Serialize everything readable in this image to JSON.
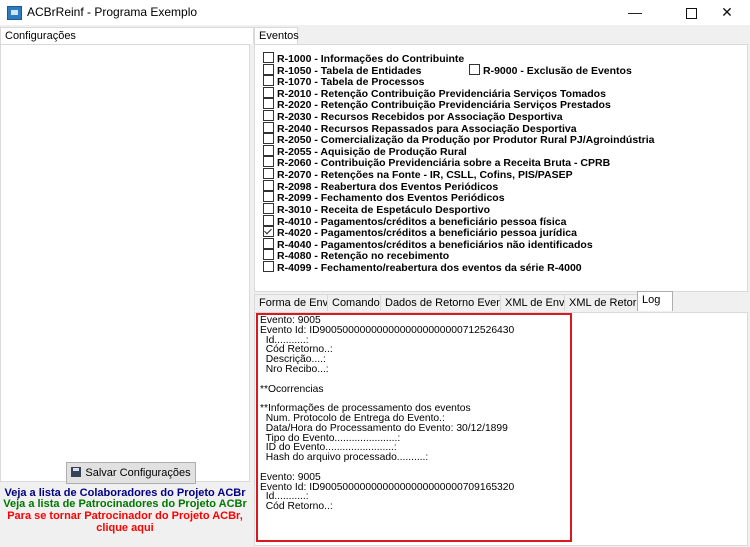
{
  "window": {
    "title": "ACBrReinf - Programa Exemplo"
  },
  "left_panel": {
    "tab_label": "Configurações",
    "save_button": "Salvar Configurações",
    "link_colaboradores": "Veja a lista de Colaboradores do Projeto ACBr",
    "link_patrocinadores": "Veja a lista de Patrocinadores do Projeto ACBr",
    "link_patrocinar_line1": "Para se tornar Patrocinador do Projeto ACBr,",
    "link_patrocinar_line2": "clique aqui",
    "colors": {
      "colaboradores": "#000080",
      "patrocinadores": "#007700",
      "patrocinar": "#ff0000"
    }
  },
  "eventos": {
    "tab_label": "Eventos",
    "items": [
      {
        "label": "R-1000 - Informações do Contribuinte",
        "checked": false
      },
      {
        "label": "R-1050 - Tabela de Entidades",
        "checked": false
      },
      {
        "label": "R-1070 - Tabela de Processos",
        "checked": false
      },
      {
        "label": "R-2010 - Retenção Contribuição Previdenciária  Serviços Tomados",
        "checked": false
      },
      {
        "label": "R-2020 - Retenção Contribuição Previdenciária  Serviços Prestados",
        "checked": false
      },
      {
        "label": "R-2030 - Recursos Recebidos por Associação Desportiva",
        "checked": false
      },
      {
        "label": "R-2040 - Recursos Repassados para Associação Desportiva",
        "checked": false
      },
      {
        "label": "R-2050 - Comercialização da Produção por Produtor Rural PJ/Agroindústria",
        "checked": false
      },
      {
        "label": "R-2055 - Aquisição de Produção Rural",
        "checked": false
      },
      {
        "label": "R-2060 - Contribuição Previdenciária sobre a Receita Bruta - CPRB",
        "checked": false
      },
      {
        "label": "R-2070 - Retenções na Fonte - IR, CSLL, Cofins, PIS/PASEP",
        "checked": false
      },
      {
        "label": "R-2098 - Reabertura dos Eventos Periódicos",
        "checked": false
      },
      {
        "label": "R-2099 - Fechamento dos Eventos Periódicos",
        "checked": false
      },
      {
        "label": "R-3010 - Receita de Espetáculo Desportivo",
        "checked": false
      },
      {
        "label": "R-4010 - Pagamentos/créditos a beneficiário pessoa física",
        "checked": false
      },
      {
        "label": "R-4020 - Pagamentos/créditos a beneficiário pessoa jurídica",
        "checked": true
      },
      {
        "label": "R-4040 - Pagamentos/créditos a beneficiários não identificados",
        "checked": false
      },
      {
        "label": "R-4080 - Retenção no recebimento",
        "checked": false
      },
      {
        "label": "R-4099 - Fechamento/reabertura dos eventos da série R-4000",
        "checked": false
      }
    ],
    "extra_item": {
      "label": "R-9000 - Exclusão de Eventos",
      "checked": false
    }
  },
  "bottom_tabs": [
    {
      "label": "Forma de Envio",
      "active": false
    },
    {
      "label": "Comandos",
      "active": false
    },
    {
      "label": "Dados de Retorno Eventos",
      "active": false
    },
    {
      "label": "XML de Envio",
      "active": false
    },
    {
      "label": "XML de Retorno",
      "active": false
    },
    {
      "label": "Log",
      "active": true
    }
  ],
  "log": {
    "highlight_color": "#d9191d",
    "lines": [
      "Evento: 9005",
      "Evento Id: ID9005000000000000000000000712526430",
      "  Id...........:",
      "  Cód Retorno..:",
      "  Descrição....:",
      "  Nro Recibo...:",
      "",
      "**Ocorrencias",
      "",
      "**Informações de processamento dos eventos",
      "  Num. Protocolo de Entrega do Evento.:",
      "  Data/Hora do Processamento do Evento: 30/12/1899",
      "  Tipo do Evento......................:",
      "  ID do Evento........................:",
      "  Hash do arquivo processado..........:",
      "",
      "Evento: 9005",
      "Evento Id: ID9005000000000000000000000709165320",
      "  Id...........:",
      "  Cód Retorno..:"
    ]
  }
}
